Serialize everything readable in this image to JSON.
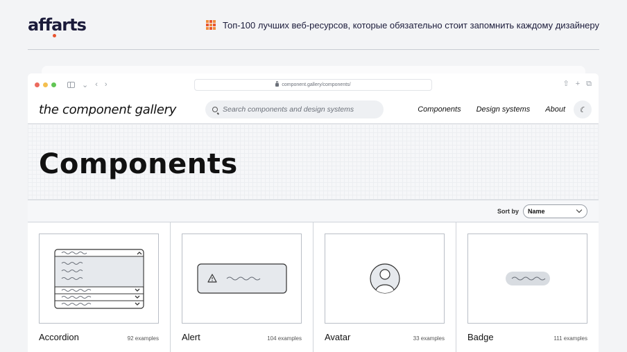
{
  "header": {
    "logo_text": "affarts",
    "headline": "Топ-100 лучших веб-ресурсов, которые обязательно стоит запомнить каждому дизайнеру"
  },
  "browser": {
    "url": "component.gallery/components/"
  },
  "site": {
    "brand": "the component gallery",
    "search_placeholder": "Search components and design systems",
    "nav": [
      "Components",
      "Design systems",
      "About"
    ],
    "theme_toggle_icon": "moon-icon"
  },
  "hero": {
    "title": "Components"
  },
  "sort": {
    "label": "Sort by",
    "value": "Name"
  },
  "cards": [
    {
      "title": "Accordion",
      "count": "92 examples",
      "icon": "accordion-illustration"
    },
    {
      "title": "Alert",
      "count": "104 examples",
      "icon": "alert-illustration"
    },
    {
      "title": "Avatar",
      "count": "33 examples",
      "icon": "avatar-illustration"
    },
    {
      "title": "Badge",
      "count": "111 examples",
      "icon": "badge-illustration"
    }
  ],
  "colors": {
    "logo_dot": "#e8542f",
    "headline_icon": "#f08c3a"
  }
}
